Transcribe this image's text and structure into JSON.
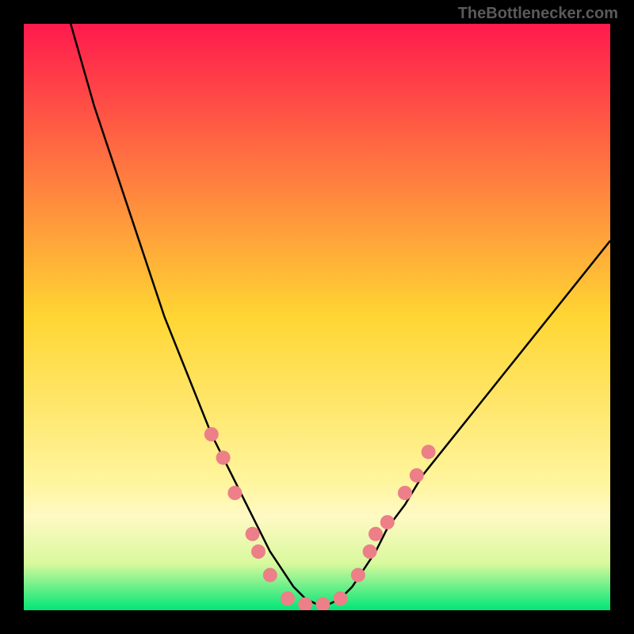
{
  "watermark": "TheBottlenecker.com",
  "chart_data": {
    "type": "line",
    "title": "",
    "xlabel": "",
    "ylabel": "",
    "xlim": [
      0,
      100
    ],
    "ylim": [
      0,
      100
    ],
    "background_gradient_stops": [
      {
        "offset": 0,
        "color": "#ff1a4d"
      },
      {
        "offset": 50,
        "color": "#ffd633"
      },
      {
        "offset": 78,
        "color": "#fff59d"
      },
      {
        "offset": 84,
        "color": "#fff9c4"
      },
      {
        "offset": 92,
        "color": "#d9f99d"
      },
      {
        "offset": 100,
        "color": "#00e676"
      }
    ],
    "series": [
      {
        "name": "curve",
        "stroke": "#000000",
        "x": [
          8,
          10,
          12,
          14,
          16,
          18,
          20,
          22,
          24,
          26,
          28,
          30,
          32,
          34,
          36,
          38,
          40,
          42,
          44,
          46,
          48,
          50,
          52,
          54,
          56,
          58,
          60,
          62,
          65,
          68,
          72,
          76,
          80,
          84,
          88,
          92,
          96,
          100
        ],
        "y": [
          100,
          93,
          86,
          80,
          74,
          68,
          62,
          56,
          50,
          45,
          40,
          35,
          30,
          26,
          22,
          18,
          14,
          10,
          7,
          4,
          2,
          1,
          1,
          2,
          4,
          7,
          10,
          14,
          18,
          23,
          28,
          33,
          38,
          43,
          48,
          53,
          58,
          63
        ]
      }
    ],
    "markers": {
      "color": "#ec7f87",
      "radius": 9,
      "points": [
        {
          "x": 32,
          "y": 30
        },
        {
          "x": 34,
          "y": 26
        },
        {
          "x": 36,
          "y": 20
        },
        {
          "x": 39,
          "y": 13
        },
        {
          "x": 40,
          "y": 10
        },
        {
          "x": 42,
          "y": 6
        },
        {
          "x": 45,
          "y": 2
        },
        {
          "x": 48,
          "y": 1
        },
        {
          "x": 51,
          "y": 1
        },
        {
          "x": 54,
          "y": 2
        },
        {
          "x": 57,
          "y": 6
        },
        {
          "x": 59,
          "y": 10
        },
        {
          "x": 60,
          "y": 13
        },
        {
          "x": 62,
          "y": 15
        },
        {
          "x": 65,
          "y": 20
        },
        {
          "x": 67,
          "y": 23
        },
        {
          "x": 69,
          "y": 27
        }
      ]
    }
  }
}
